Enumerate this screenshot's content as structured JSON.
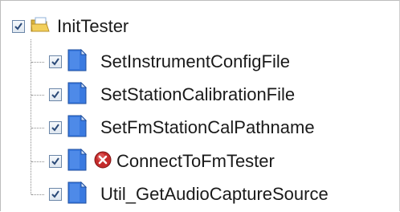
{
  "tree": {
    "root": {
      "label": "InitTester",
      "checked": true,
      "icon": "open-folder-icon"
    },
    "children": [
      {
        "label": "SetInstrumentConfigFile",
        "checked": true,
        "icon": "document-icon"
      },
      {
        "label": "SetStationCalibrationFile",
        "checked": true,
        "icon": "document-icon"
      },
      {
        "label": "SetFmStationCalPathname",
        "checked": true,
        "icon": "document-icon"
      },
      {
        "label": "ConnectToFmTester",
        "checked": true,
        "icon": "document-icon",
        "status_icon": "error-icon"
      },
      {
        "label": "Util_GetAudioCaptureSource",
        "checked": true,
        "icon": "document-icon"
      }
    ]
  },
  "colors": {
    "check_mark": "#2b4a78",
    "checkbox_border": "#6b86a8",
    "document_blue": "#2f6fd6",
    "folder_yellow": "#e8c14a",
    "error_red": "#c42b2b"
  }
}
